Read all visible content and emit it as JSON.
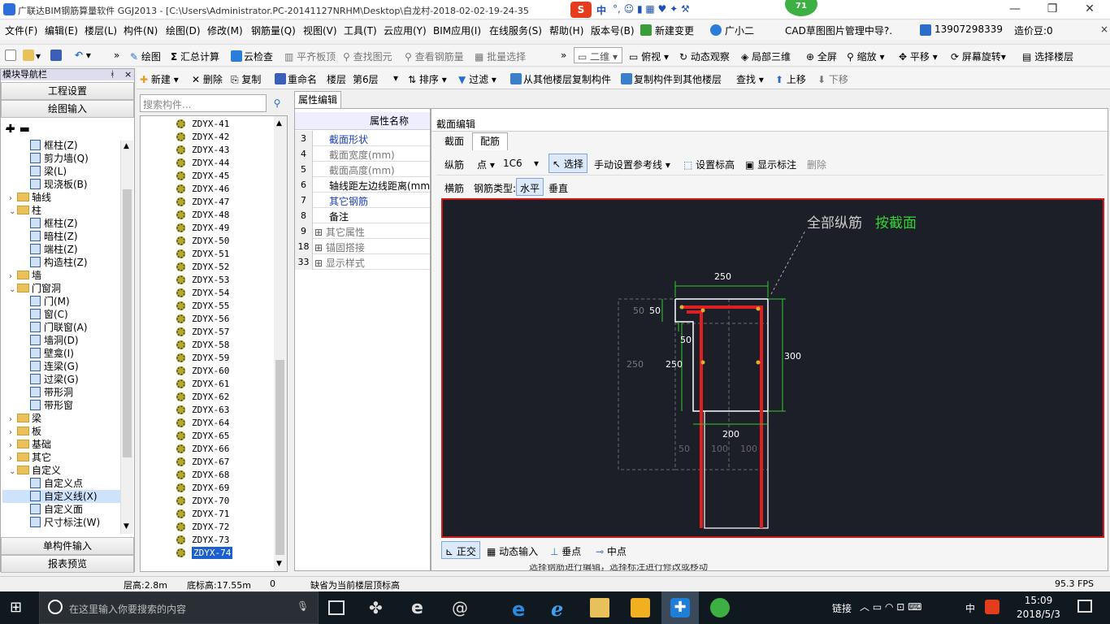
{
  "title": {
    "text": "广联达BIM钢筋算量软件 GGJ2013 - [C:\\Users\\Administrator.PC-20141127NRHM\\Desktop\\白龙村-2018-02-02-19-24-35",
    "badge_count": "71",
    "ime_label": "中"
  },
  "menu": {
    "items": [
      "文件(F)",
      "编辑(E)",
      "楼层(L)",
      "构件(N)",
      "绘图(D)",
      "修改(M)",
      "钢筋量(Q)",
      "视图(V)",
      "工具(T)",
      "云应用(Y)",
      "BIM应用(I)",
      "在线服务(S)",
      "帮助(H)",
      "版本号(B)",
      "新建变更",
      "广小二"
    ],
    "cad_link": "CAD草图图片管理中导?.",
    "phone": "13907298339",
    "cost_beans": "造价豆:0"
  },
  "toolbar1": {
    "draw": "绘图",
    "sum": "汇总计算",
    "cloud_check": "云检查",
    "flatten": "平齐板顶",
    "find_elem": "查找图元",
    "view_rebar": "查看钢筋量",
    "batch_select": "批量选择",
    "view_mode": "二维",
    "top_view": "俯视",
    "dynamic": "动态观察",
    "local3d": "局部三维",
    "fullscreen": "全屏",
    "zoom": "缩放",
    "pan": "平移",
    "rotate": "屏幕旋转",
    "select_floor": "选择楼层"
  },
  "toolbar2": {
    "new": "新建",
    "delete": "删除",
    "copy": "复制",
    "rename": "重命名",
    "floor_label": "楼层",
    "floor_value": "第6层",
    "sort": "排序",
    "filter": "过滤",
    "copy_from": "从其他楼层复制构件",
    "copy_to": "复制构件到其他楼层",
    "find": "查找",
    "up": "上移",
    "down": "下移"
  },
  "nav": {
    "header": "模块导航栏",
    "pin": "ᚼ",
    "close": "×",
    "project_settings": "工程设置",
    "drawing_input": "绘图输入",
    "single_input": "单构件输入",
    "report_preview": "报表预览",
    "tree": [
      {
        "label": "框柱(Z)",
        "level": 2
      },
      {
        "label": "剪力墙(Q)",
        "level": 2
      },
      {
        "label": "梁(L)",
        "level": 2
      },
      {
        "label": "现浇板(B)",
        "level": 2
      },
      {
        "label": "轴线",
        "level": 1,
        "folder": true,
        "exp": "›"
      },
      {
        "label": "柱",
        "level": 1,
        "folder": true,
        "exp": "⌄"
      },
      {
        "label": "框柱(Z)",
        "level": 2
      },
      {
        "label": "暗柱(Z)",
        "level": 2
      },
      {
        "label": "端柱(Z)",
        "level": 2
      },
      {
        "label": "构造柱(Z)",
        "level": 2
      },
      {
        "label": "墙",
        "level": 1,
        "folder": true,
        "exp": "›"
      },
      {
        "label": "门窗洞",
        "level": 1,
        "folder": true,
        "exp": "⌄"
      },
      {
        "label": "门(M)",
        "level": 2
      },
      {
        "label": "窗(C)",
        "level": 2
      },
      {
        "label": "门联窗(A)",
        "level": 2
      },
      {
        "label": "墙洞(D)",
        "level": 2
      },
      {
        "label": "壁龛(I)",
        "level": 2
      },
      {
        "label": "连梁(G)",
        "level": 2
      },
      {
        "label": "过梁(G)",
        "level": 2
      },
      {
        "label": "带形洞",
        "level": 2
      },
      {
        "label": "带形窗",
        "level": 2
      },
      {
        "label": "梁",
        "level": 1,
        "folder": true,
        "exp": "›"
      },
      {
        "label": "板",
        "level": 1,
        "folder": true,
        "exp": "›"
      },
      {
        "label": "基础",
        "level": 1,
        "folder": true,
        "exp": "›"
      },
      {
        "label": "其它",
        "level": 1,
        "folder": true,
        "exp": "›"
      },
      {
        "label": "自定义",
        "level": 1,
        "folder": true,
        "exp": "⌄"
      },
      {
        "label": "自定义点",
        "level": 2
      },
      {
        "label": "自定义线(X)",
        "level": 2,
        "selected": true
      },
      {
        "label": "自定义面",
        "level": 2
      },
      {
        "label": "尺寸标注(W)",
        "level": 2
      }
    ]
  },
  "list": {
    "search_placeholder": "搜索构件...",
    "items": [
      "ZDYX-41",
      "ZDYX-42",
      "ZDYX-43",
      "ZDYX-44",
      "ZDYX-45",
      "ZDYX-46",
      "ZDYX-47",
      "ZDYX-48",
      "ZDYX-49",
      "ZDYX-50",
      "ZDYX-51",
      "ZDYX-52",
      "ZDYX-53",
      "ZDYX-54",
      "ZDYX-55",
      "ZDYX-56",
      "ZDYX-57",
      "ZDYX-58",
      "ZDYX-59",
      "ZDYX-60",
      "ZDYX-61",
      "ZDYX-62",
      "ZDYX-63",
      "ZDYX-64",
      "ZDYX-65",
      "ZDYX-66",
      "ZDYX-67",
      "ZDYX-68",
      "ZDYX-69",
      "ZDYX-70",
      "ZDYX-71",
      "ZDYX-72",
      "ZDYX-73",
      "ZDYX-74"
    ],
    "selected": "ZDYX-74"
  },
  "props": {
    "tab": "属性编辑",
    "header": "属性名称",
    "rows": [
      {
        "num": "3",
        "name": "截面形状",
        "color": "#1a3fc0",
        "plus": false
      },
      {
        "num": "4",
        "name": "截面宽度(mm)",
        "color": "#777",
        "plus": false
      },
      {
        "num": "5",
        "name": "截面高度(mm)",
        "color": "#777",
        "plus": false
      },
      {
        "num": "6",
        "name": "轴线距左边线距离(mm)",
        "color": "#000",
        "plus": false
      },
      {
        "num": "7",
        "name": "其它钢筋",
        "color": "#1a3fc0",
        "plus": false
      },
      {
        "num": "8",
        "name": "备注",
        "color": "#000",
        "plus": false
      },
      {
        "num": "9",
        "name": "其它属性",
        "color": "#777",
        "plus": true
      },
      {
        "num": "18",
        "name": "锚固搭接",
        "color": "#777",
        "plus": true
      },
      {
        "num": "33",
        "name": "显示样式",
        "color": "#777",
        "plus": true
      }
    ]
  },
  "editor": {
    "title": "截面编辑",
    "tabs": [
      "截面",
      "配筋"
    ],
    "active_tab": "配筋",
    "row1": {
      "long_rebar": "纵筋",
      "point": "点",
      "spec": "1C6",
      "select": "选择",
      "manual_ref": "手动设置参考线",
      "set_elev": "设置标高",
      "show_label": "显示标注",
      "delete": "删除"
    },
    "row2": {
      "stirrup": "横筋",
      "type_label": "钢筋类型:",
      "horizontal": "水平",
      "vertical": "垂直"
    },
    "canvas": {
      "note_prefix": "全部纵筋",
      "note_value": "按截面",
      "dims": {
        "top": "250",
        "left_top": "50",
        "left_top2": "50",
        "inner": "50",
        "left_ghost": "250",
        "left": "250",
        "right": "300",
        "bottom": "200",
        "g1": "50",
        "g2": "100",
        "g3": "100"
      }
    },
    "bottom": {
      "ortho": "正交",
      "dyn_input": "动态输入",
      "perp": "垂点",
      "mid": "中点"
    },
    "hint": "选择钢筋进行编辑，选择标注进行修改或移动"
  },
  "status": {
    "floor_height": "层高:2.8m",
    "base_elev": "底标高:17.55m",
    "zero": "0",
    "default_top": "缺省为当前楼层顶标高",
    "fps": "95.3 FPS"
  },
  "taskbar": {
    "search_placeholder": "在这里输入你要搜索的内容",
    "link": "链接",
    "ime": "中",
    "time": "15:09",
    "date": "2018/5/3"
  }
}
